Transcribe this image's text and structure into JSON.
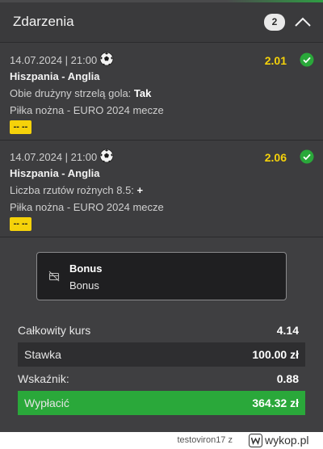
{
  "header": {
    "title": "Zdarzenia",
    "count": "2",
    "collapse_icon": "chevron-up-icon"
  },
  "events": [
    {
      "datetime": "14.07.2024 | 21:00",
      "sport_icon": "soccer-ball-icon",
      "odds": "2.01",
      "status_icon": "check-circle-icon",
      "match": "Hiszpania - Anglia",
      "market": "Obie drużyny strzelą gola:",
      "selection": "Tak",
      "league": "Piłka nożna - EURO 2024 mecze",
      "badge": "-- --"
    },
    {
      "datetime": "14.07.2024 | 21:00",
      "sport_icon": "soccer-ball-icon",
      "odds": "2.06",
      "status_icon": "check-circle-icon",
      "match": "Hiszpania - Anglia",
      "market": "Liczba rzutów rożnych 8.5:",
      "selection": "+",
      "league": "Piłka nożna - EURO 2024 mecze",
      "badge": "-- --"
    }
  ],
  "bonus": {
    "icon": "no-bonus-icon",
    "title": "Bonus",
    "subtitle": "Bonus"
  },
  "summary": {
    "total_odds_label": "Całkowity kurs",
    "total_odds_value": "4.14",
    "stake_label": "Stawka",
    "stake_value": "100.00 zł",
    "indicator_label": "Wskaźnik:",
    "indicator_value": "0.88",
    "payout_label": "Wypłacić",
    "payout_value": "364.32 zł"
  },
  "footer": {
    "user": "testoviron17",
    "separator": "z",
    "site": "wykop.pl"
  },
  "colors": {
    "odds": "#f5d20a",
    "success": "#2aa83a",
    "background": "#3d3d3f"
  }
}
